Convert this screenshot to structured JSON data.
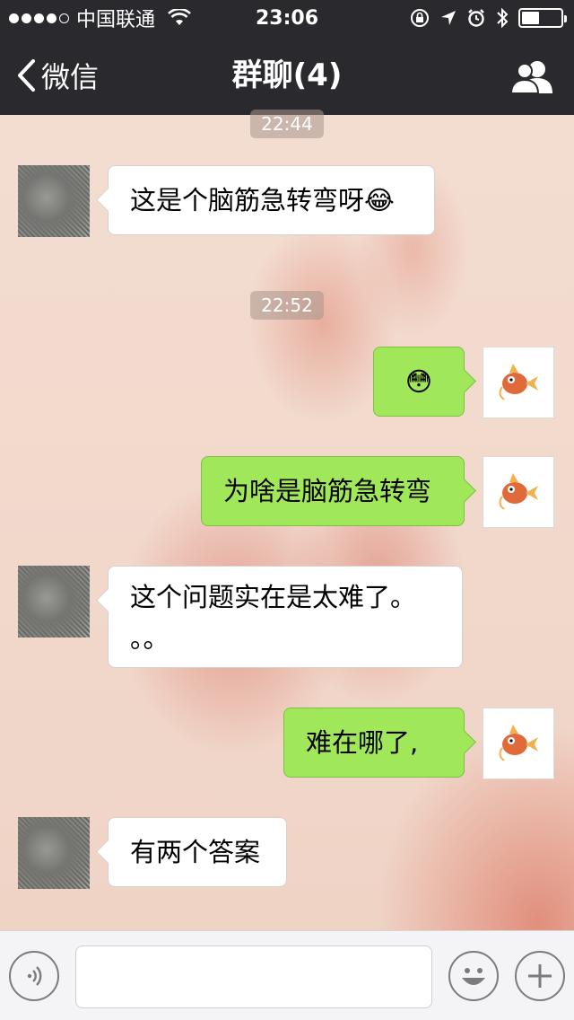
{
  "status_bar": {
    "carrier": "中国联通",
    "time": "23:06",
    "signal_bars_filled": 4,
    "signal_bars_total": 5,
    "battery_level": 0.45,
    "icons": [
      "signal-icon",
      "wifi-icon",
      "orientation-lock-icon",
      "location-icon",
      "alarm-icon",
      "bluetooth-icon",
      "battery-icon"
    ]
  },
  "nav": {
    "back_label": "微信",
    "title": "群聊(4)",
    "right_icon": "group-members-icon"
  },
  "chat": {
    "timestamps": [
      "22:44",
      "22:52"
    ],
    "messages": [
      {
        "sender": "other",
        "text": "这是个脑筋急转弯呀😂"
      },
      {
        "sender": "me",
        "text": "😳"
      },
      {
        "sender": "me",
        "text": "为啥是脑筋急转弯"
      },
      {
        "sender": "other",
        "text": "这个问题实在是太难了。。。",
        "line1": "这个问题实在是太难了。",
        "line2": "。。"
      },
      {
        "sender": "me",
        "text": "难在哪了,"
      },
      {
        "sender": "other",
        "text": "有两个答案"
      }
    ]
  },
  "input_bar": {
    "voice_icon": "voice-icon",
    "text_value": "",
    "emoji_icon": "emoji-icon",
    "plus_icon": "plus-icon"
  },
  "colors": {
    "nav_background": "#2a2a2e",
    "outgoing_bubble": "#a0e75a",
    "incoming_bubble": "#ffffff",
    "timestamp_bg": "#aa968c"
  }
}
